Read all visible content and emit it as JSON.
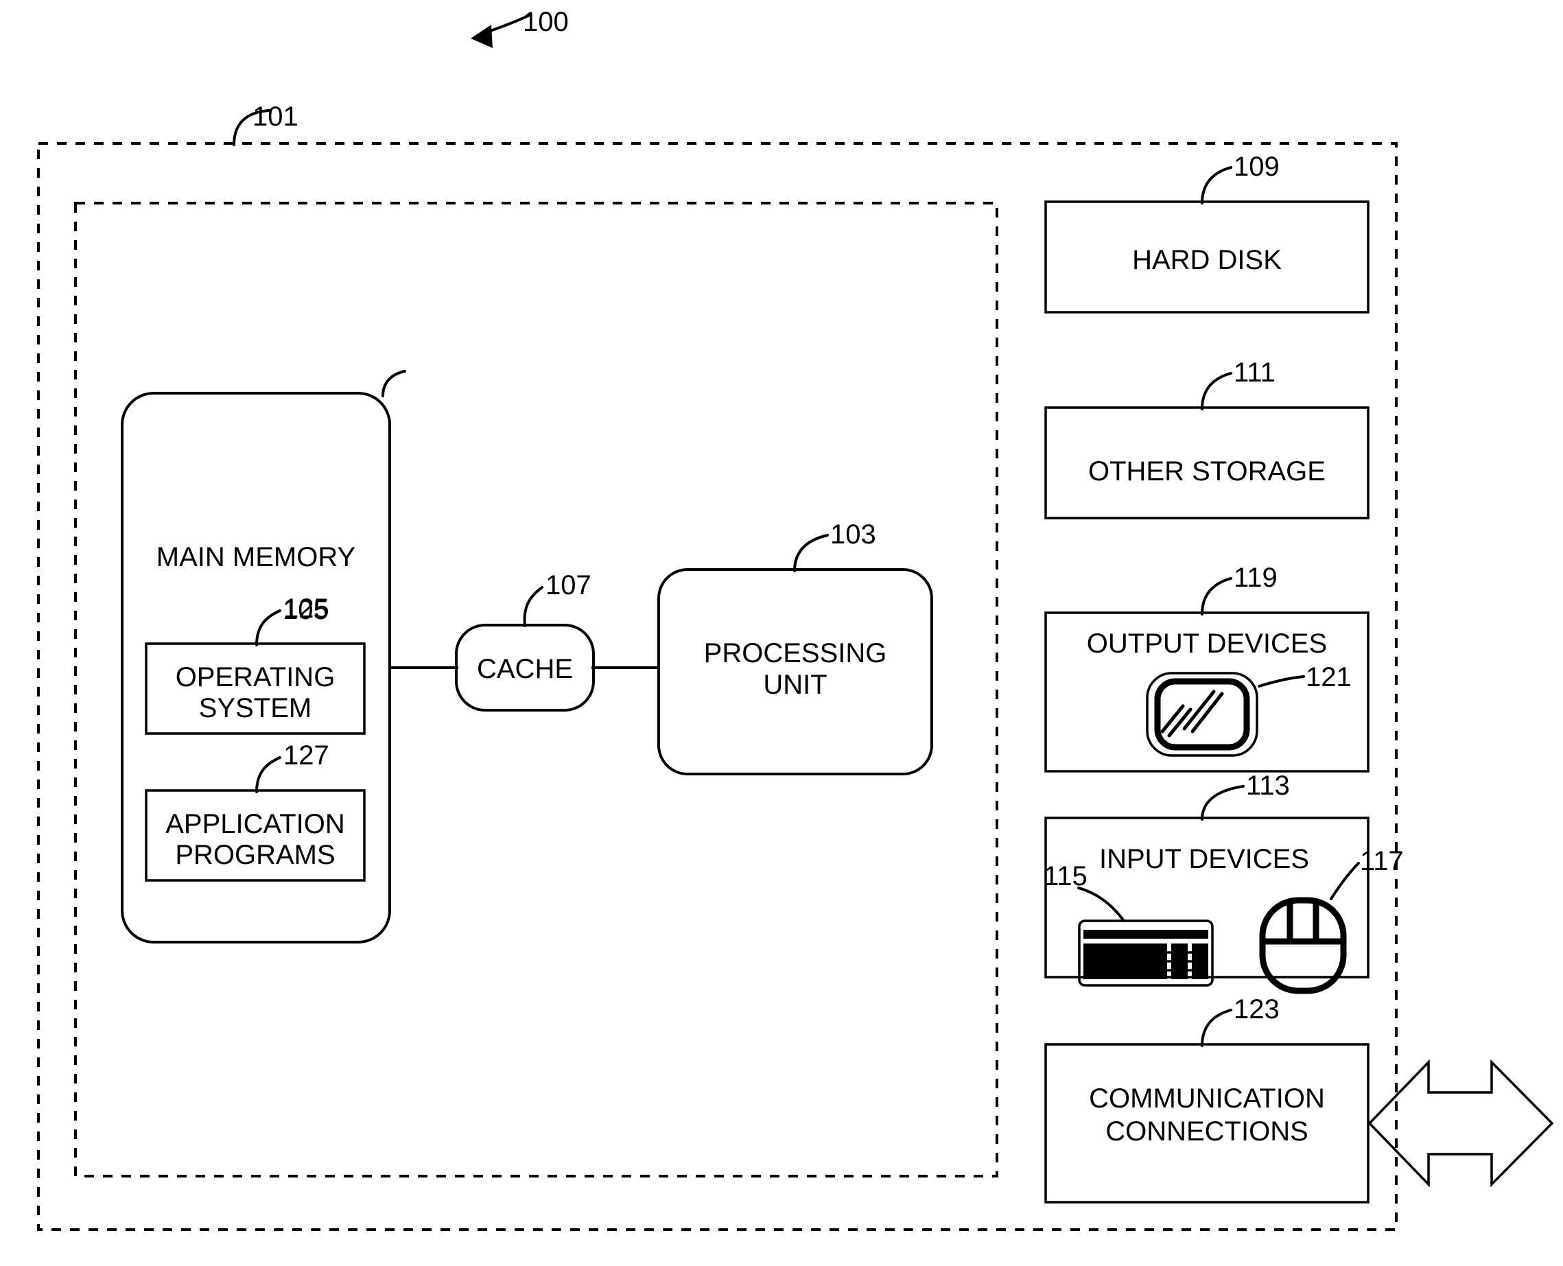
{
  "figure": {
    "number": "100",
    "system_ref": "101",
    "inner_ref": null
  },
  "labels": {
    "fig_100": "100",
    "system_101": "101",
    "processing_unit_103": "103",
    "main_memory_105": "105",
    "cache_107": "107",
    "hard_disk_109": "109",
    "other_storage_111": "111",
    "input_devices_113": "113",
    "keyboard_115": "115",
    "mouse_117": "117",
    "output_devices_119": "119",
    "monitor_121": "121",
    "communication_123": "123",
    "operating_system_125": "125",
    "application_programs_127": "127"
  },
  "blocks": {
    "main_memory": "MAIN MEMORY",
    "operating_system_line1": "OPERATING",
    "operating_system_line2": "SYSTEM",
    "application_programs_line1": "APPLICATION",
    "application_programs_line2": "PROGRAMS",
    "cache": "CACHE",
    "processing_unit_line1": "PROCESSING",
    "processing_unit_line2": "UNIT",
    "hard_disk": "HARD DISK",
    "other_storage": "OTHER STORAGE",
    "output_devices": "OUTPUT DEVICES",
    "input_devices": "INPUT DEVICES",
    "communication_line1": "COMMUNICATION",
    "communication_line2": "CONNECTIONS"
  },
  "icons": {
    "monitor": "monitor-icon",
    "keyboard": "keyboard-icon",
    "mouse": "mouse-icon",
    "bidirectional_arrow": "bidirectional-arrow-icon",
    "figure_pointer": "figure-pointer-arrow-icon"
  },
  "colors": {
    "ink": "#000000",
    "paper": "#ffffff"
  }
}
